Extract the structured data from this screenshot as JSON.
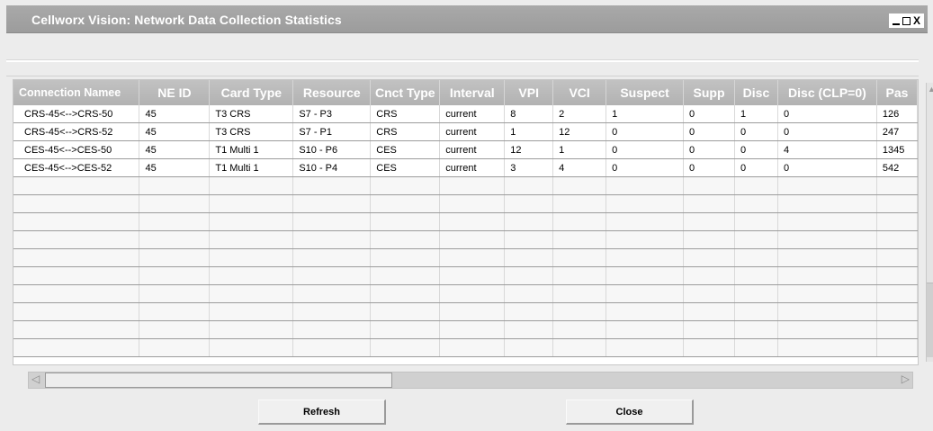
{
  "window": {
    "title": "Cellworx Vision:  Network Data Collection Statistics",
    "controls": {
      "minimize": "_",
      "maximize": "□",
      "close": "X"
    }
  },
  "table": {
    "columns": [
      "Connection Namee",
      "NE ID",
      "Card Type",
      "Resource",
      "Cnct Type",
      "Interval",
      "VPI",
      "VCI",
      "Suspect",
      "Supp",
      "Disc",
      "Disc (CLP=0)",
      "Pas"
    ],
    "rows": [
      [
        "CRS-45<-->CRS-50",
        "45",
        "T3 CRS",
        "S7 - P3",
        "CRS",
        "current",
        "8",
        "2",
        "1",
        "0",
        "1",
        "0",
        "126"
      ],
      [
        "CRS-45<-->CRS-52",
        "45",
        "T3 CRS",
        "S7 - P1",
        "CRS",
        "current",
        "1",
        "12",
        "0",
        "0",
        "0",
        "0",
        "247"
      ],
      [
        "CES-45<-->CES-50",
        "45",
        "T1 Multi 1",
        "S10 - P6",
        "CES",
        "current",
        "12",
        "1",
        "0",
        "0",
        "0",
        "4",
        "1345"
      ],
      [
        "CES-45<-->CES-52",
        "45",
        "T1 Multi 1",
        "S10 - P4",
        "CES",
        "current",
        "3",
        "4",
        "0",
        "0",
        "0",
        "0",
        "542"
      ]
    ],
    "empty_rows": 10
  },
  "buttons": {
    "refresh": "Refresh",
    "close": "Close"
  }
}
